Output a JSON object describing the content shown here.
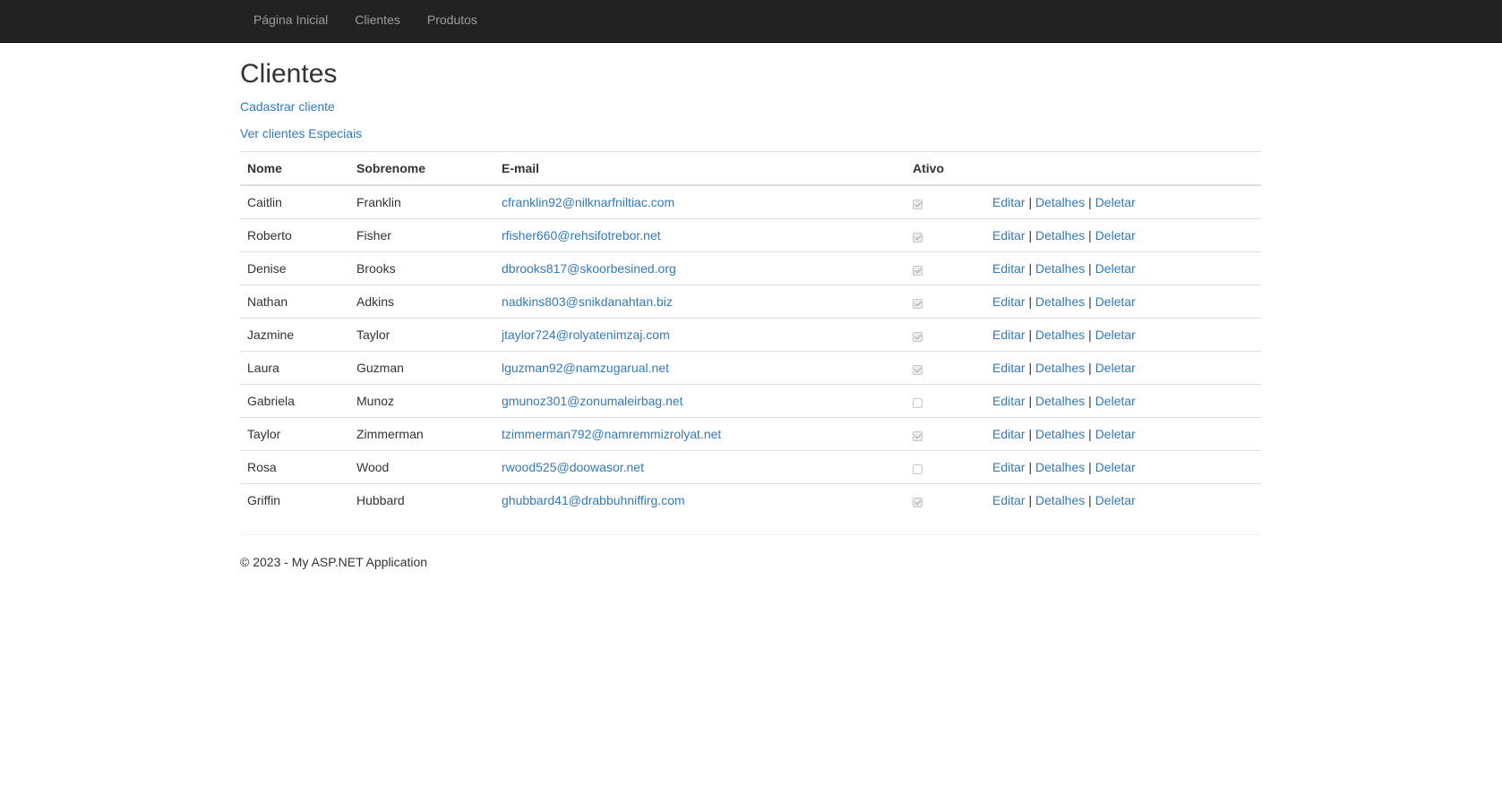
{
  "nav": {
    "items": [
      "Página Inicial",
      "Clientes",
      "Produtos"
    ]
  },
  "page": {
    "title": "Clientes",
    "create_link": "Cadastrar cliente",
    "special_link": "Ver clientes Especiais"
  },
  "table": {
    "headers": [
      "Nome",
      "Sobrenome",
      "E-mail",
      "Ativo",
      ""
    ],
    "action_labels": {
      "edit": "Editar",
      "details": "Detalhes",
      "delete": "Deletar",
      "separator": "|"
    },
    "rows": [
      {
        "nome": "Caitlin",
        "sobrenome": "Franklin",
        "email": "cfranklin92@nilknarfniltiac.com",
        "ativo": true
      },
      {
        "nome": "Roberto",
        "sobrenome": "Fisher",
        "email": "rfisher660@rehsifotrebor.net",
        "ativo": true
      },
      {
        "nome": "Denise",
        "sobrenome": "Brooks",
        "email": "dbrooks817@skoorbesined.org",
        "ativo": true
      },
      {
        "nome": "Nathan",
        "sobrenome": "Adkins",
        "email": "nadkins803@snikdanahtan.biz",
        "ativo": true
      },
      {
        "nome": "Jazmine",
        "sobrenome": "Taylor",
        "email": "jtaylor724@rolyatenimzaj.com",
        "ativo": true
      },
      {
        "nome": "Laura",
        "sobrenome": "Guzman",
        "email": "lguzman92@namzugarual.net",
        "ativo": true
      },
      {
        "nome": "Gabriela",
        "sobrenome": "Munoz",
        "email": "gmunoz301@zonumaleirbag.net",
        "ativo": false
      },
      {
        "nome": "Taylor",
        "sobrenome": "Zimmerman",
        "email": "tzimmerman792@namremmizrolyat.net",
        "ativo": true
      },
      {
        "nome": "Rosa",
        "sobrenome": "Wood",
        "email": "rwood525@doowasor.net",
        "ativo": false
      },
      {
        "nome": "Griffin",
        "sobrenome": "Hubbard",
        "email": "ghubbard41@drabbuhniffirg.com",
        "ativo": true
      }
    ]
  },
  "footer": {
    "text": "© 2023 - My ASP.NET Application"
  },
  "colors": {
    "navbar_bg": "#222222",
    "nav_text": "#9d9d9d",
    "link": "#337ab7",
    "text": "#333333",
    "border": "#dddddd"
  }
}
